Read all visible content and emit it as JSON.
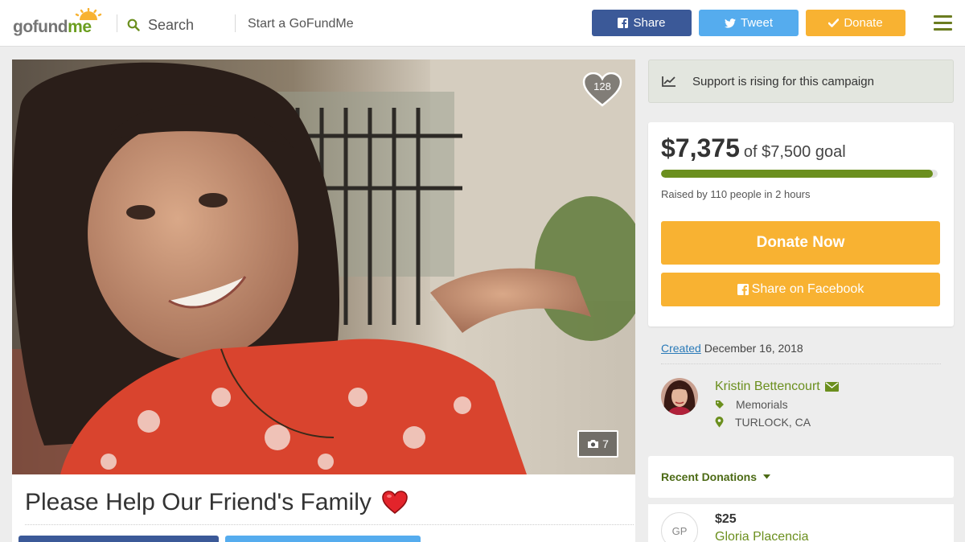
{
  "header": {
    "logo": "gofundme",
    "search_label": "Search",
    "start_label": "Start a GoFundMe",
    "share_label": "Share",
    "tweet_label": "Tweet",
    "donate_label": "Donate"
  },
  "campaign": {
    "hearts": "128",
    "photo_count": "7",
    "title": "Please Help Our Friend's Family"
  },
  "sidebar": {
    "rising_text": "Support is rising for this campaign",
    "raised": "$7,375",
    "goal": "of $7,500 goal",
    "progress_percent": 98.3,
    "raised_by": "Raised by 110 people in 2 hours",
    "donate_now": "Donate Now",
    "share_facebook": "Share on Facebook",
    "created_link": "Created",
    "created_date": "December 16, 2018",
    "organizer": "Kristin Bettencourt",
    "category": "Memorials",
    "location": "TURLOCK, CA",
    "recent_donations": "Recent Donations",
    "donation": {
      "initials": "GP",
      "amount": "$25",
      "name": "Gloria Placencia"
    }
  },
  "colors": {
    "facebook": "#3b5998",
    "twitter": "#55acee",
    "donate": "#f8b232",
    "brand_green": "#6b8f1e"
  }
}
